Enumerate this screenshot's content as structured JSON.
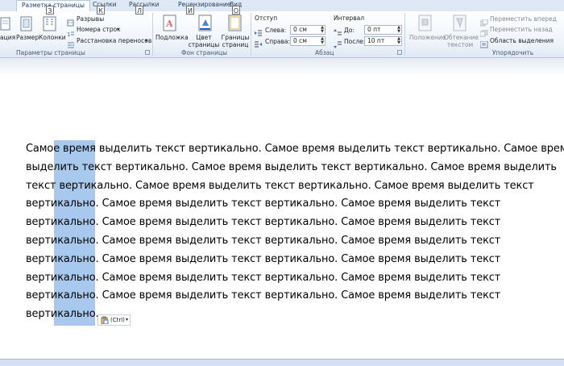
{
  "tabs": [
    {
      "label": "Разметка страницы",
      "keytip": "З",
      "active": true
    },
    {
      "label": "Ссылки",
      "keytip": "К",
      "active": false
    },
    {
      "label": "Рассылки",
      "keytip": "Л",
      "active": false
    },
    {
      "label": "Рецензирование",
      "keytip": "И",
      "active": false
    },
    {
      "label": "Вид",
      "keytip": "О",
      "active": false
    }
  ],
  "page_setup": {
    "orientation_label": "ация",
    "size_label": "Размер",
    "columns_label": "Колонки",
    "breaks_label": "Разрывы",
    "line_numbers_label": "Номера строк",
    "hyphenation_label": "Расстановка переносов",
    "group_label": "Параметры страницы"
  },
  "page_background": {
    "watermark_label": "Подложка",
    "page_color_label": "Цвет страницы",
    "page_borders_label": "Границы страниц",
    "group_label": "Фон страницы"
  },
  "paragraph": {
    "indent_header": "Отступ",
    "left_label": "Слева:",
    "left_value": "0 см",
    "right_label": "Справа:",
    "right_value": "0 см",
    "spacing_header": "Интервал",
    "before_label": "До:",
    "before_value": "0 пт",
    "after_label": "После:",
    "after_value": "10 пт",
    "group_label": "Абзац"
  },
  "arrange": {
    "position_label": "Положение",
    "wrap_label": "Обтекание текстом",
    "bring_forward_label": "Переместить вперед",
    "send_backward_label": "Переместить назад",
    "selection_pane_label": "Область выделения",
    "group_label": "Упорядочить"
  },
  "document": {
    "lines": [
      "Самое время выделить текст вертикально. Самое время выделить текст вертикально. Самое время",
      "выделить текст вертикально. Самое время выделить текст вертикально. Самое время выделить",
      "текст вертикально. Самое время выделить текст вертикально. Самое время выделить текст",
      "вертикально. Самое время выделить текст вертикально. Самое время выделить текст",
      "вертикально. Самое время выделить текст вертикально. Самое время выделить текст",
      "вертикально. Самое время выделить текст вертикально. Самое время выделить текст",
      "вертикально. Самое время выделить текст вертикально. Самое время выделить текст",
      "вертикально. Самое время выделить текст вертикально. Самое время выделить текст",
      "вертикально. Самое время выделить текст вертикально. Самое время выделить текст",
      "вертикально."
    ]
  },
  "paste_options": {
    "label": "(Ctrl)"
  },
  "colors": {
    "selection": "#a9c8ee",
    "ribbon_accent": "#1e395b",
    "tab_bar": "#dfe9f5"
  }
}
